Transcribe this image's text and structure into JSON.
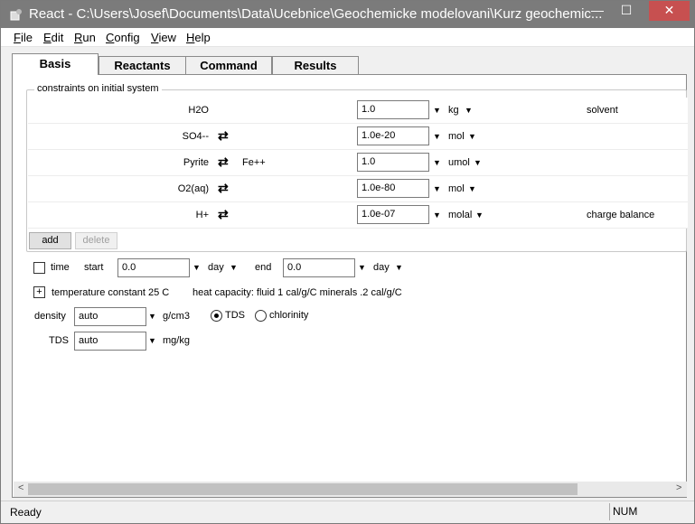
{
  "window": {
    "title": "React - C:\\Users\\Josef\\Documents\\Data\\Ucebnice\\Geochemicke modelovani\\Kurz geochemic...",
    "minimize": "—",
    "maximize": "☐",
    "close": "✕"
  },
  "menu": [
    {
      "label": "File",
      "hotkey": "F",
      "rest": "ile"
    },
    {
      "label": "Edit",
      "hotkey": "E",
      "rest": "dit"
    },
    {
      "label": "Run",
      "hotkey": "R",
      "rest": "un"
    },
    {
      "label": "Config",
      "hotkey": "C",
      "rest": "onfig"
    },
    {
      "label": "View",
      "hotkey": "V",
      "rest": "iew"
    },
    {
      "label": "Help",
      "hotkey": "H",
      "rest": "elp"
    }
  ],
  "tabs": [
    "Basis",
    "Reactants",
    "Command",
    "Results"
  ],
  "group_label": "constraints on initial system",
  "constraints": [
    {
      "species": "H2O",
      "swap": "",
      "swap_with": "",
      "amount": "1.0",
      "unit": "kg",
      "role": "solvent"
    },
    {
      "species": "SO4--",
      "swap": "⇄",
      "swap_with": "",
      "amount": "1.0e-20",
      "unit": "mol",
      "role": ""
    },
    {
      "species": "Pyrite",
      "swap": "⇄",
      "swap_with": "Fe++",
      "amount": "1.0",
      "unit": "umol",
      "role": ""
    },
    {
      "species": "O2(aq)",
      "swap": "⇄",
      "swap_with": "",
      "amount": "1.0e-80",
      "unit": "mol",
      "role": ""
    },
    {
      "species": "H+",
      "swap": "⇄",
      "swap_with": "",
      "amount": "1.0e-07",
      "unit": "molal",
      "role": "charge balance"
    }
  ],
  "buttons": {
    "add": "add",
    "delete": "delete"
  },
  "time": {
    "label": "time",
    "start_label": "start",
    "start": "0.0",
    "start_unit": "day",
    "end_label": "end",
    "end": "0.0",
    "end_unit": "day"
  },
  "temperature": {
    "toggle": "+",
    "text": "temperature  constant 25 C",
    "heat": "heat capacity:  fluid 1 cal/g/C   minerals .2 cal/g/C"
  },
  "density": {
    "label": "density",
    "value": "auto",
    "unit": "g/cm3",
    "opt1": "TDS",
    "opt2": "chlorinity"
  },
  "tds": {
    "label": "TDS",
    "value": "auto",
    "unit": "mg/kg"
  },
  "status": {
    "text": "Ready",
    "num": "NUM"
  }
}
